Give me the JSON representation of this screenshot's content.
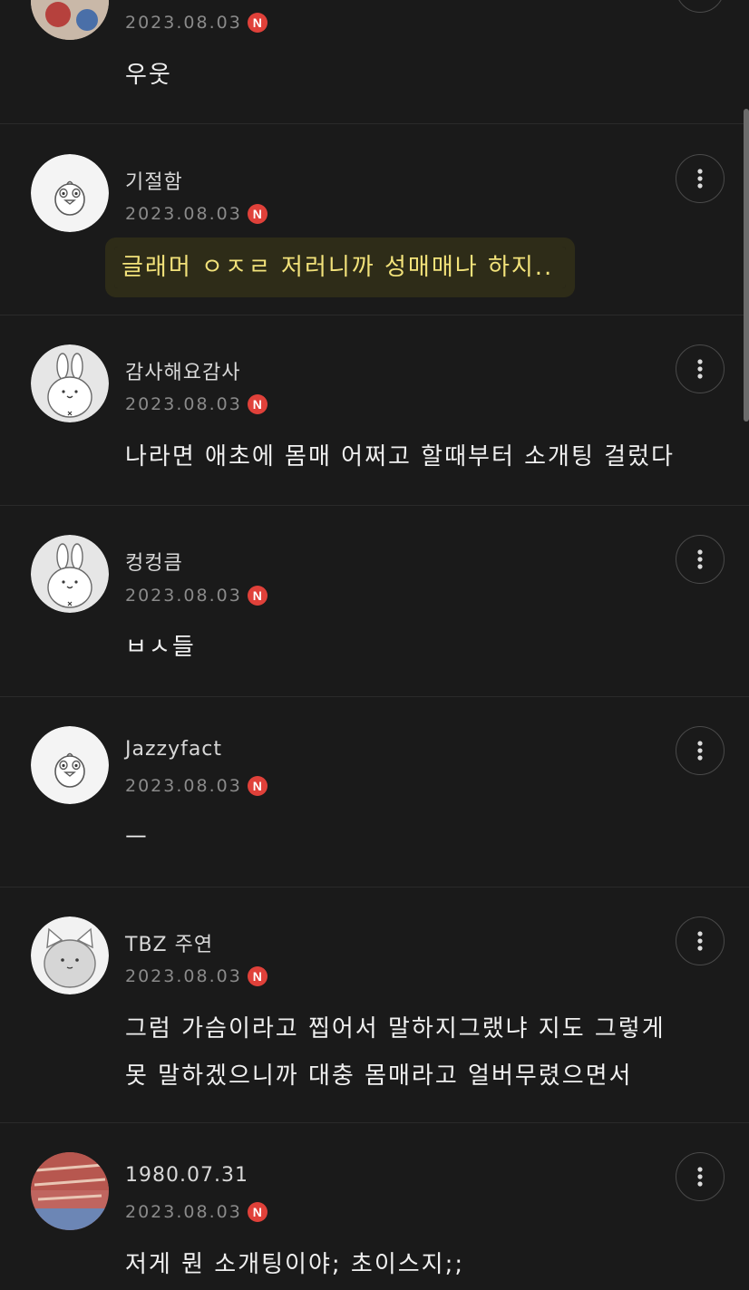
{
  "comments": [
    {
      "nickname": "",
      "date": "2023.08.03",
      "badge": "N",
      "text": "우웃",
      "avatar": "photo-avatar",
      "highlight": false
    },
    {
      "nickname": "기절함",
      "date": "2023.08.03",
      "badge": "N",
      "text": "글래머 ㅇㅈㄹ 저러니까 성매매나 하지..",
      "avatar": "chick-avatar",
      "highlight": true
    },
    {
      "nickname": "감사해요감사",
      "date": "2023.08.03",
      "badge": "N",
      "text": "나라면 애초에 몸매 어쩌고 할때부터 소개팅 걸렀다",
      "avatar": "rabbit-avatar",
      "highlight": false
    },
    {
      "nickname": "컹컹큼",
      "date": "2023.08.03",
      "badge": "N",
      "text": "ㅂㅅ들",
      "avatar": "rabbit-avatar",
      "highlight": false
    },
    {
      "nickname": "Jazzyfact",
      "date": "2023.08.03",
      "badge": "N",
      "text": "ㅡ",
      "avatar": "chick-avatar",
      "highlight": false
    },
    {
      "nickname": "TBZ 주연",
      "date": "2023.08.03",
      "badge": "N",
      "text": "그럼 가슴이라고 찝어서 말하지그랬냐 지도 그렇게 못 말하겠으니까 대충 몸매라고 얼버무렸으면서",
      "avatar": "cat-avatar",
      "highlight": false
    },
    {
      "nickname": "1980.07.31",
      "date": "2023.08.03",
      "badge": "N",
      "text": "저게 뭔 소개팅이야; 초이스지;;",
      "avatar": "cake-avatar",
      "highlight": false
    }
  ],
  "colors": {
    "background": "#1a1a1a",
    "badge": "#e0413a",
    "highlight_text": "#f2e27a",
    "date": "#8a8a8a"
  },
  "icons": {
    "more": "more-vertical-icon",
    "new": "new-badge"
  }
}
